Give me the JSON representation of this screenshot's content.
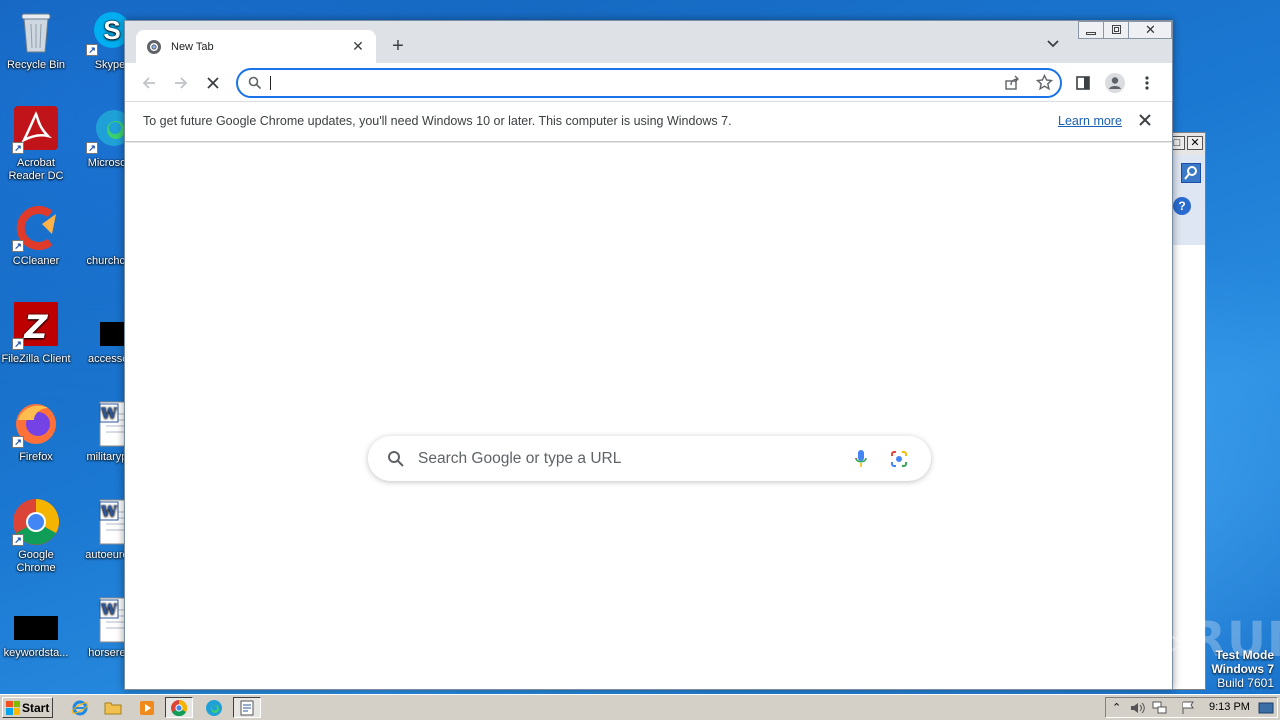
{
  "desktop": {
    "icons": [
      {
        "label": "Recycle Bin"
      },
      {
        "label": "Skype"
      },
      {
        "label": "Acrobat Reader DC"
      },
      {
        "label": "Microsoft"
      },
      {
        "label": "CCleaner"
      },
      {
        "label": "churchcol"
      },
      {
        "label": "FileZilla Client"
      },
      {
        "label": "accessor"
      },
      {
        "label": "Firefox"
      },
      {
        "label": "militarypu"
      },
      {
        "label": "Google Chrome"
      },
      {
        "label": "autoeurop"
      },
      {
        "label": "keywordsta..."
      },
      {
        "label": "horsereg"
      }
    ]
  },
  "browser": {
    "tab": {
      "title": "New Tab"
    },
    "omnibox": {
      "value": "",
      "placeholder": ""
    },
    "infobar": {
      "message": "To get future Google Chrome updates, you'll need Windows 10 or later. This computer is using Windows 7.",
      "link": "Learn more"
    },
    "search": {
      "placeholder": "Search Google or type a URL"
    }
  },
  "watermark": {
    "brand": "ANY RUN"
  },
  "os_badge": {
    "line1": "Test Mode",
    "line2": "Windows 7",
    "line3": "Build 7601"
  },
  "taskbar": {
    "start_label": "Start",
    "clock": "9:13 PM"
  },
  "colors": {
    "accent": "#1a73e8",
    "desktop": "#1d6fc6",
    "taskbar": "#d4d0c8"
  }
}
